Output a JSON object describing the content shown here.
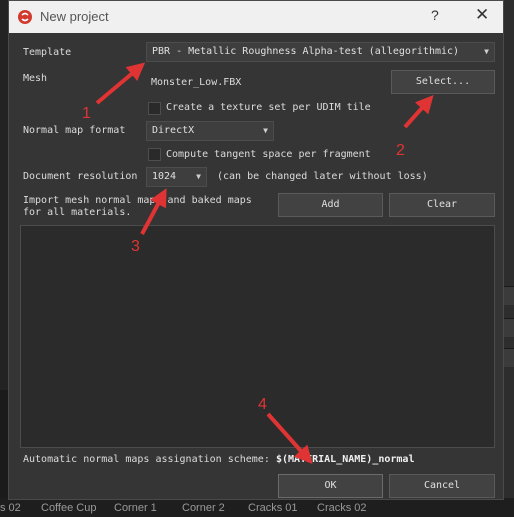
{
  "window": {
    "title": "New project",
    "help_glyph": "?",
    "close_glyph": "✕"
  },
  "template": {
    "label": "Template",
    "value": "PBR - Metallic Roughness Alpha-test (allegorithmic)"
  },
  "mesh": {
    "label": "Mesh",
    "file": "Monster_Low.FBX",
    "select_label": "Select..."
  },
  "udim": {
    "label": "Create a texture set per UDIM tile",
    "checked": false
  },
  "normal_map": {
    "label": "Normal map format",
    "value": "DirectX"
  },
  "tangent": {
    "label": "Compute tangent space per fragment",
    "checked": false
  },
  "resolution": {
    "label": "Document resolution",
    "value": "1024",
    "note": "(can be changed later without loss)"
  },
  "import_maps": {
    "line1": "Import mesh normal maps and baked maps",
    "line2": "for all materials.",
    "add_label": "Add",
    "clear_label": "Clear"
  },
  "auto_assign": {
    "label": "Automatic normal maps assignation scheme:",
    "scheme": "$(MATERIAL_NAME)_normal"
  },
  "footer": {
    "ok_label": "OK",
    "cancel_label": "Cancel"
  },
  "background_shelf": [
    "s 02",
    "Coffee Cup",
    "Corner 1",
    "Corner 2",
    "Cracks 01",
    "Cracks 02"
  ],
  "annotations": [
    "1",
    "2",
    "3",
    "4"
  ],
  "colors": {
    "annotation": "#e03434",
    "dialog_bg": "#353535",
    "titlebar_bg": "#f0f0f0"
  }
}
